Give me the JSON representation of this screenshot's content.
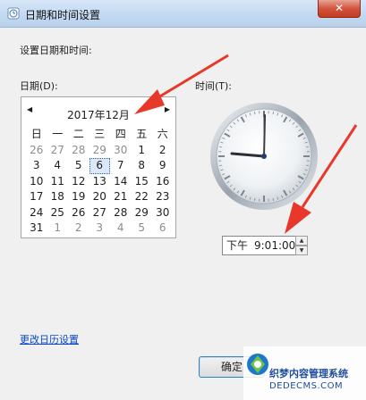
{
  "window": {
    "title": "日期和时间设置",
    "close_label": "✕"
  },
  "section": {
    "heading": "设置日期和时间:",
    "date_label": "日期(D):",
    "time_label": "时间(T):"
  },
  "calendar": {
    "month_title": "2017年12月",
    "prev_label": "◀",
    "next_label": "▶",
    "weekdays": [
      "日",
      "一",
      "二",
      "三",
      "四",
      "五",
      "六"
    ],
    "days": [
      [
        "26",
        "27",
        "28",
        "29",
        "30",
        "1",
        "2"
      ],
      [
        "3",
        "4",
        "5",
        "6",
        "7",
        "8",
        "9"
      ],
      [
        "10",
        "11",
        "12",
        "13",
        "14",
        "15",
        "16"
      ],
      [
        "17",
        "18",
        "19",
        "20",
        "21",
        "22",
        "23"
      ],
      [
        "24",
        "25",
        "26",
        "27",
        "28",
        "29",
        "30"
      ],
      [
        "31",
        "1",
        "2",
        "3",
        "4",
        "5",
        "6"
      ]
    ],
    "selected_day": "6"
  },
  "time": {
    "ampm": "下午",
    "value": "9:01:00",
    "spin_up": "▲",
    "spin_down": "▼"
  },
  "links": {
    "calendar_settings": "更改日历设置"
  },
  "buttons": {
    "ok": "确定"
  },
  "watermark": {
    "line1": "织梦内容管理系统",
    "line2": "DEDECMS.COM"
  },
  "colors": {
    "accent_arrow": "#e8382a",
    "link": "#0a47c9"
  }
}
